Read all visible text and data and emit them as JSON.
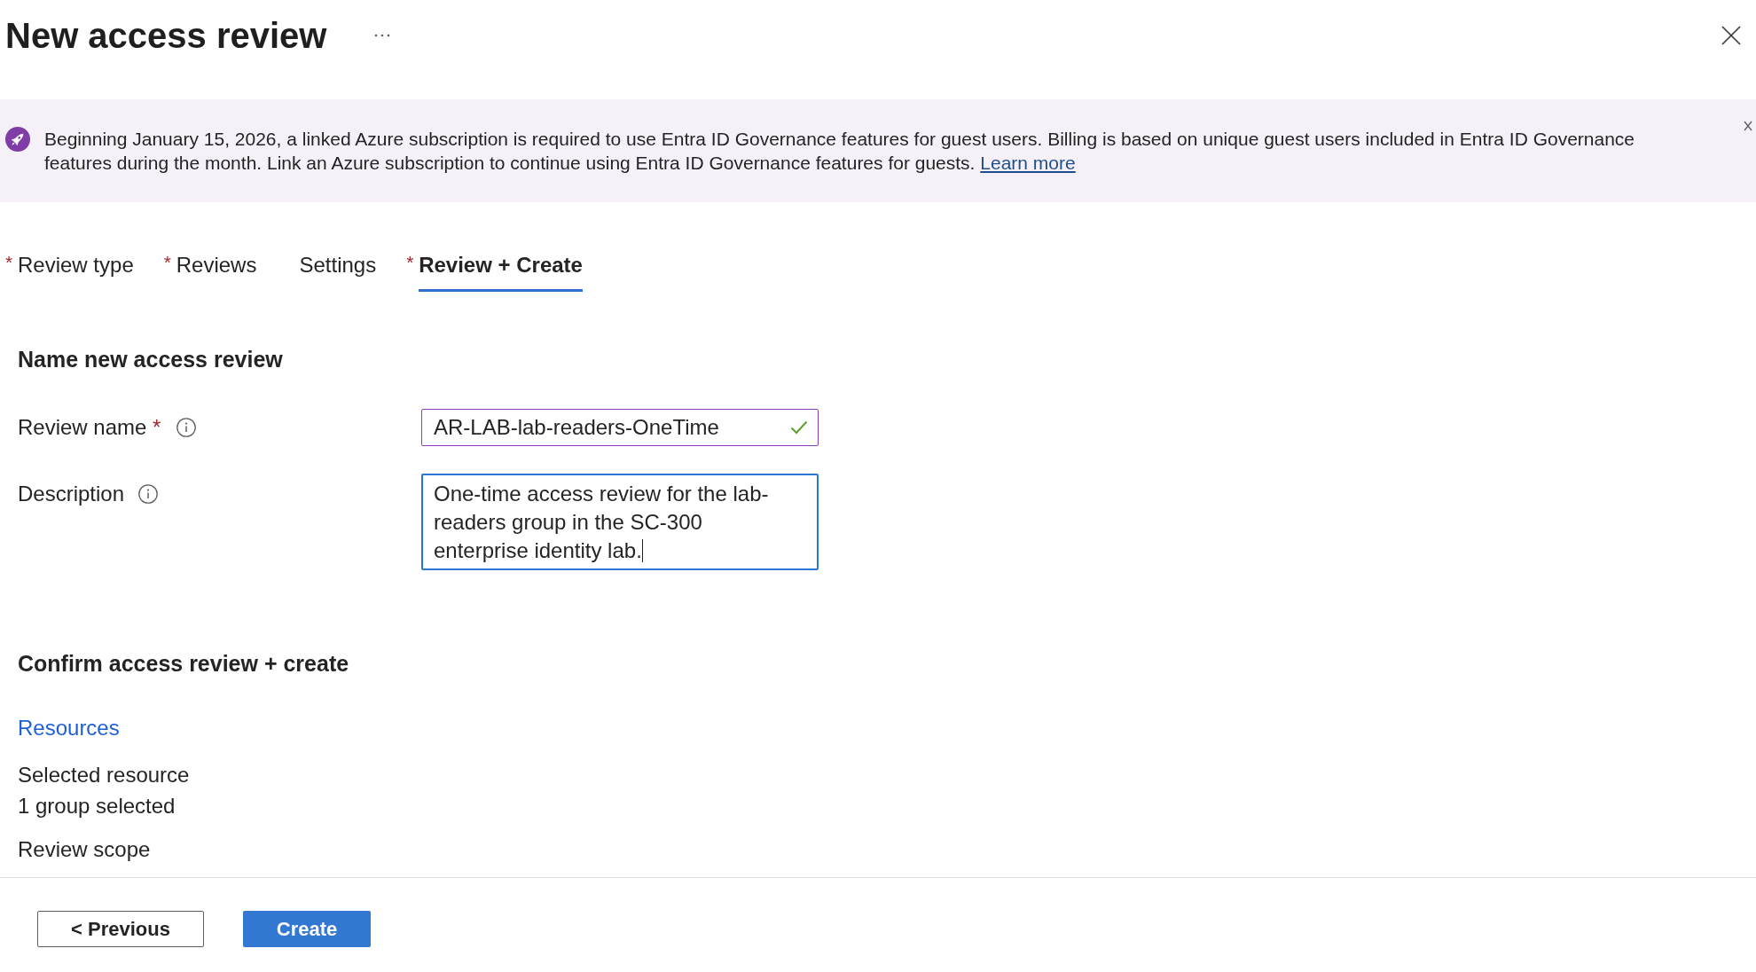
{
  "header": {
    "title": "New access review"
  },
  "banner": {
    "text": "Beginning January 15, 2026, a linked Azure subscription is required to use Entra ID Governance features for guest users. Billing is based on unique guest users included in Entra ID Governance features during the month. Link an Azure subscription to continue using Entra ID Governance features for guests.",
    "link": "Learn more"
  },
  "tabs": [
    {
      "label": "Review type",
      "required_mark": "*",
      "selected": false
    },
    {
      "label": "Reviews",
      "required_mark": "*",
      "selected": false
    },
    {
      "label": "Settings",
      "selected": false
    },
    {
      "label": "Review + Create",
      "required_mark": "*",
      "selected": true
    }
  ],
  "name_section": {
    "heading": "Name new access review",
    "fields": [
      {
        "kind": "input",
        "label": "Review name",
        "required_mark": "*",
        "value": "AR-LAB-lab-readers-OneTime",
        "valid": true,
        "focused": false
      },
      {
        "kind": "textarea",
        "label": "Description",
        "value": "One-time access review for the lab-readers group in the SC-300 enterprise identity lab.",
        "focused": true
      }
    ]
  },
  "confirm_section": {
    "heading": "Confirm access review + create",
    "group_title": "Resources",
    "items": [
      {
        "label": "Selected resource",
        "value": "1 group selected"
      },
      {
        "label": "Review scope"
      }
    ]
  },
  "footer": {
    "buttons": [
      {
        "label": "< Previous",
        "kind": "secondary"
      },
      {
        "label": "Create",
        "kind": "primary"
      }
    ]
  }
}
